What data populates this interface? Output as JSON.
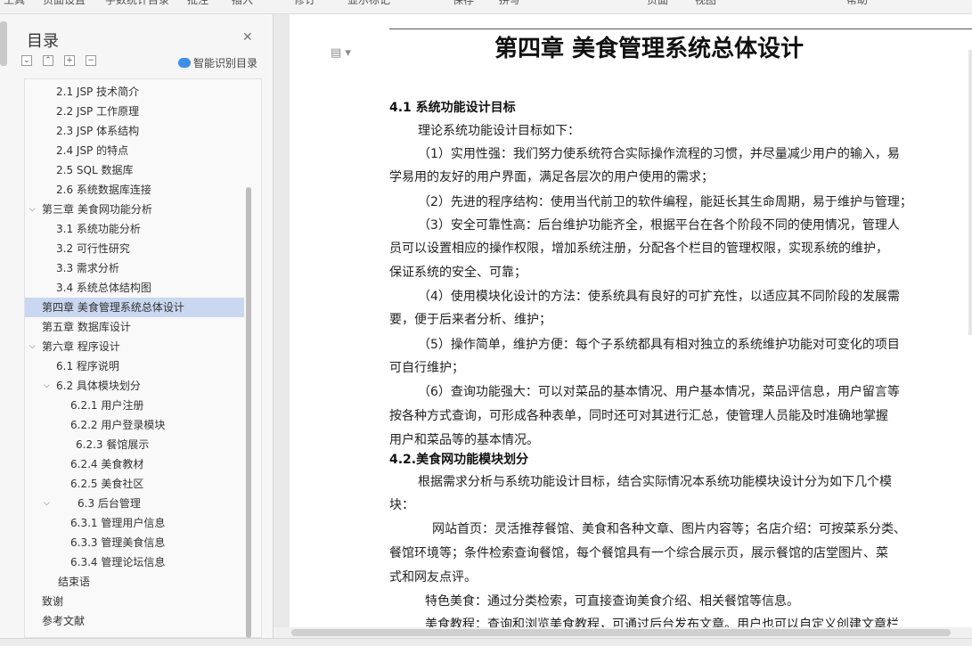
{
  "toolbar": {
    "items": [
      "工具",
      "页面设置",
      "字数统计",
      "目录",
      "批注",
      "插入",
      "修订",
      "显示标记",
      "保存",
      "拼写",
      "页面",
      "视图",
      "帮助"
    ]
  },
  "toc": {
    "title": "目录",
    "smart_label": "智能识别目录",
    "controls": [
      "⌄",
      "⌃",
      "+",
      "−"
    ],
    "items": [
      {
        "label": "2.1 JSP 技术简介",
        "arrow": ""
      },
      {
        "label": "2.2 JSP 工作原理",
        "arrow": ""
      },
      {
        "label": "2.3 JSP 体系结构",
        "arrow": ""
      },
      {
        "label": "2.4 JSP 的特点",
        "arrow": ""
      },
      {
        "label": "2.5 SQL  数据库",
        "arrow": ""
      },
      {
        "label": "2.6  系统数据库连接",
        "arrow": ""
      },
      {
        "label": "第三章   美食网功能分析",
        "arrow": "⌵"
      },
      {
        "label": "3.1    系统功能分析",
        "arrow": ""
      },
      {
        "label": "3.2    可行性研究",
        "arrow": ""
      },
      {
        "label": "3.3      需求分析",
        "arrow": ""
      },
      {
        "label": "3.4  系统总体结构图",
        "arrow": ""
      },
      {
        "label": "第四章    美食管理系统总体设计",
        "arrow": ""
      },
      {
        "label": "第五章  数据库设计",
        "arrow": ""
      },
      {
        "label": "第六章    程序设计",
        "arrow": "⌵"
      },
      {
        "label": "6.1  程序说明",
        "arrow": ""
      },
      {
        "label": "6.2  具体模块划分",
        "arrow": "⌵"
      },
      {
        "label": "6.2.1 用户注册",
        "arrow": ""
      },
      {
        "label": "6.2.2 用户登录模块",
        "arrow": ""
      },
      {
        "label": "6.2.3 餐馆展示",
        "arrow": ""
      },
      {
        "label": "6.2.4 美食教材",
        "arrow": ""
      },
      {
        "label": "6.2.5 美食社区",
        "arrow": ""
      },
      {
        "label": "6.3 后台管理",
        "arrow": "⌵"
      },
      {
        "label": "6.3.1 管理用户信息",
        "arrow": ""
      },
      {
        "label": "6.3.3 管理美食信息",
        "arrow": ""
      },
      {
        "label": "6.3.4 管理论坛信息",
        "arrow": ""
      },
      {
        "label": "结束语",
        "arrow": ""
      },
      {
        "label": "致谢",
        "arrow": ""
      },
      {
        "label": "参考文献",
        "arrow": ""
      }
    ]
  },
  "doc": {
    "icon": "▤ ▾",
    "chapter_title": "第四章    美食管理系统总体设计",
    "h_41": "4.1  系统功能设计目标",
    "h_42": "4.2.美食网功能模块划分",
    "lines": [
      "理论系统功能设计目标如下：",
      "（1）实用性强：我们努力使系统符合实际操作流程的习惯，并尽量减少用户的输入，易",
      "学易用的友好的用户界面，满足各层次的用户使用的需求；",
      "（2）先进的程序结构：使用当代前卫的软件编程，能延长其生命周期，易于维护与管理；",
      "（3）安全可靠性高：后台维护功能齐全，根据平台在各个阶段不同的使用情况，管理人",
      "员可以设置相应的操作权限，增加系统注册，分配各个栏目的管理权限，实现系统的维护，",
      "保证系统的安全、可靠；",
      "（4）使用模块化设计的方法：使系统具有良好的可扩充性，以适应其不同阶段的发展需",
      "要，便于后来者分析、维护；",
      "（5）操作简单，维护方便：每个子系统都具有相对独立的系统维护功能对可变化的项目",
      "可自行维护；",
      "（6）查询功能强大：可以对菜品的基本情况、用户基本情况，菜品评信息，用户留言等",
      "按各种方式查询，可形成各种表单，同时还可对其进行汇总，使管理人员能及时准确地掌握",
      "用户和菜品等的基本情况。",
      "根据需求分析与系统功能设计目标，结合实际情况本系统功能模块设计分为如下几个模",
      "块：",
      "网站首页：灵活推荐餐馆、美食和各种文章、图片内容等；名店介绍：可按菜系分类、",
      "餐馆环境等；条件检索查询餐馆，每个餐馆具有一个综合展示页，展示餐馆的店堂图片、菜",
      "式和网友点评。",
      "特色美食：通过分类检索，可直接查询美食介绍、相关餐馆等信息。",
      "美食教程：查询和浏览美食教程，可通过后台发布文章。用户也可以自定义创建文章栏"
    ]
  }
}
